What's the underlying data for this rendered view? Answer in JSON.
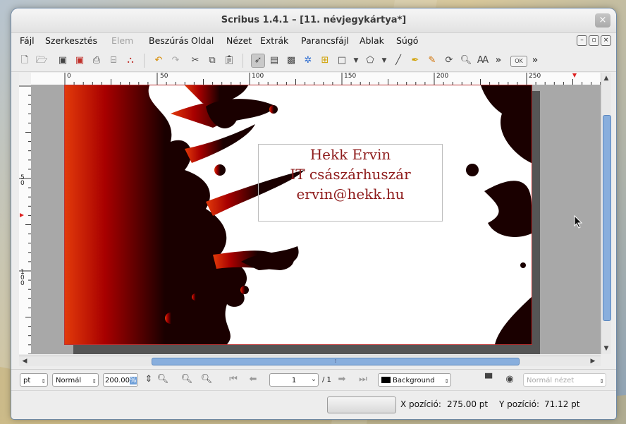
{
  "window": {
    "title": "Scribus 1.4.1 – [11. névjegykártya*]",
    "close": "×"
  },
  "menu": {
    "items": [
      "Fájl",
      "Szerkesztés",
      "Elem",
      "Beszúrás",
      "Oldal",
      "Nézet",
      "Extrák",
      "Parancsfájl",
      "Ablak",
      "Súgó"
    ],
    "disabled": [
      "Elem"
    ]
  },
  "toolbar": {
    "icons": [
      "new-document-icon",
      "open-icon",
      "save-icon",
      "close-document-icon",
      "print-icon",
      "preflight-icon",
      "pdf-export-icon",
      "undo-icon",
      "redo-icon",
      "cut-icon",
      "copy-icon",
      "paste-icon",
      "select-icon",
      "text-frame-icon",
      "image-frame-icon",
      "render-frame-icon",
      "table-icon",
      "shape-icon",
      "polygon-icon",
      "line-icon",
      "bezier-icon",
      "freehand-icon",
      "rotate-icon",
      "zoom-icon",
      "edit-contents-icon",
      "more-icon",
      "pdf-push-button-icon",
      "more-icon-2"
    ],
    "overflow": "»",
    "ok_label": "OK"
  },
  "rulers": {
    "h_labels": [
      "0",
      "50",
      "100",
      "150",
      "200",
      "250"
    ],
    "v_labels": [
      "5\n0",
      "1\n0\n0"
    ]
  },
  "document": {
    "text_lines": [
      "Hekk Ervin",
      "IT császárhuszár",
      "ervin@hekk.hu"
    ]
  },
  "colors": {
    "splash_dark": "#1a0000",
    "splash_red": "#a80000",
    "splash_orange": "#e23a0a",
    "text": "#8e1b1b",
    "scroll_thumb": "#88aedd"
  },
  "bottom": {
    "unit": "pt",
    "mode": "Normál",
    "zoom": "200.00",
    "zoom_suffix": "%",
    "page_current": "1",
    "page_total": "/ 1",
    "layer": "Background",
    "view_mode": "Normál nézet"
  },
  "status": {
    "x_label": "X pozíció:",
    "x_value": "275.00 pt",
    "y_label": "Y pozíció:",
    "y_value": "71.12 pt"
  }
}
